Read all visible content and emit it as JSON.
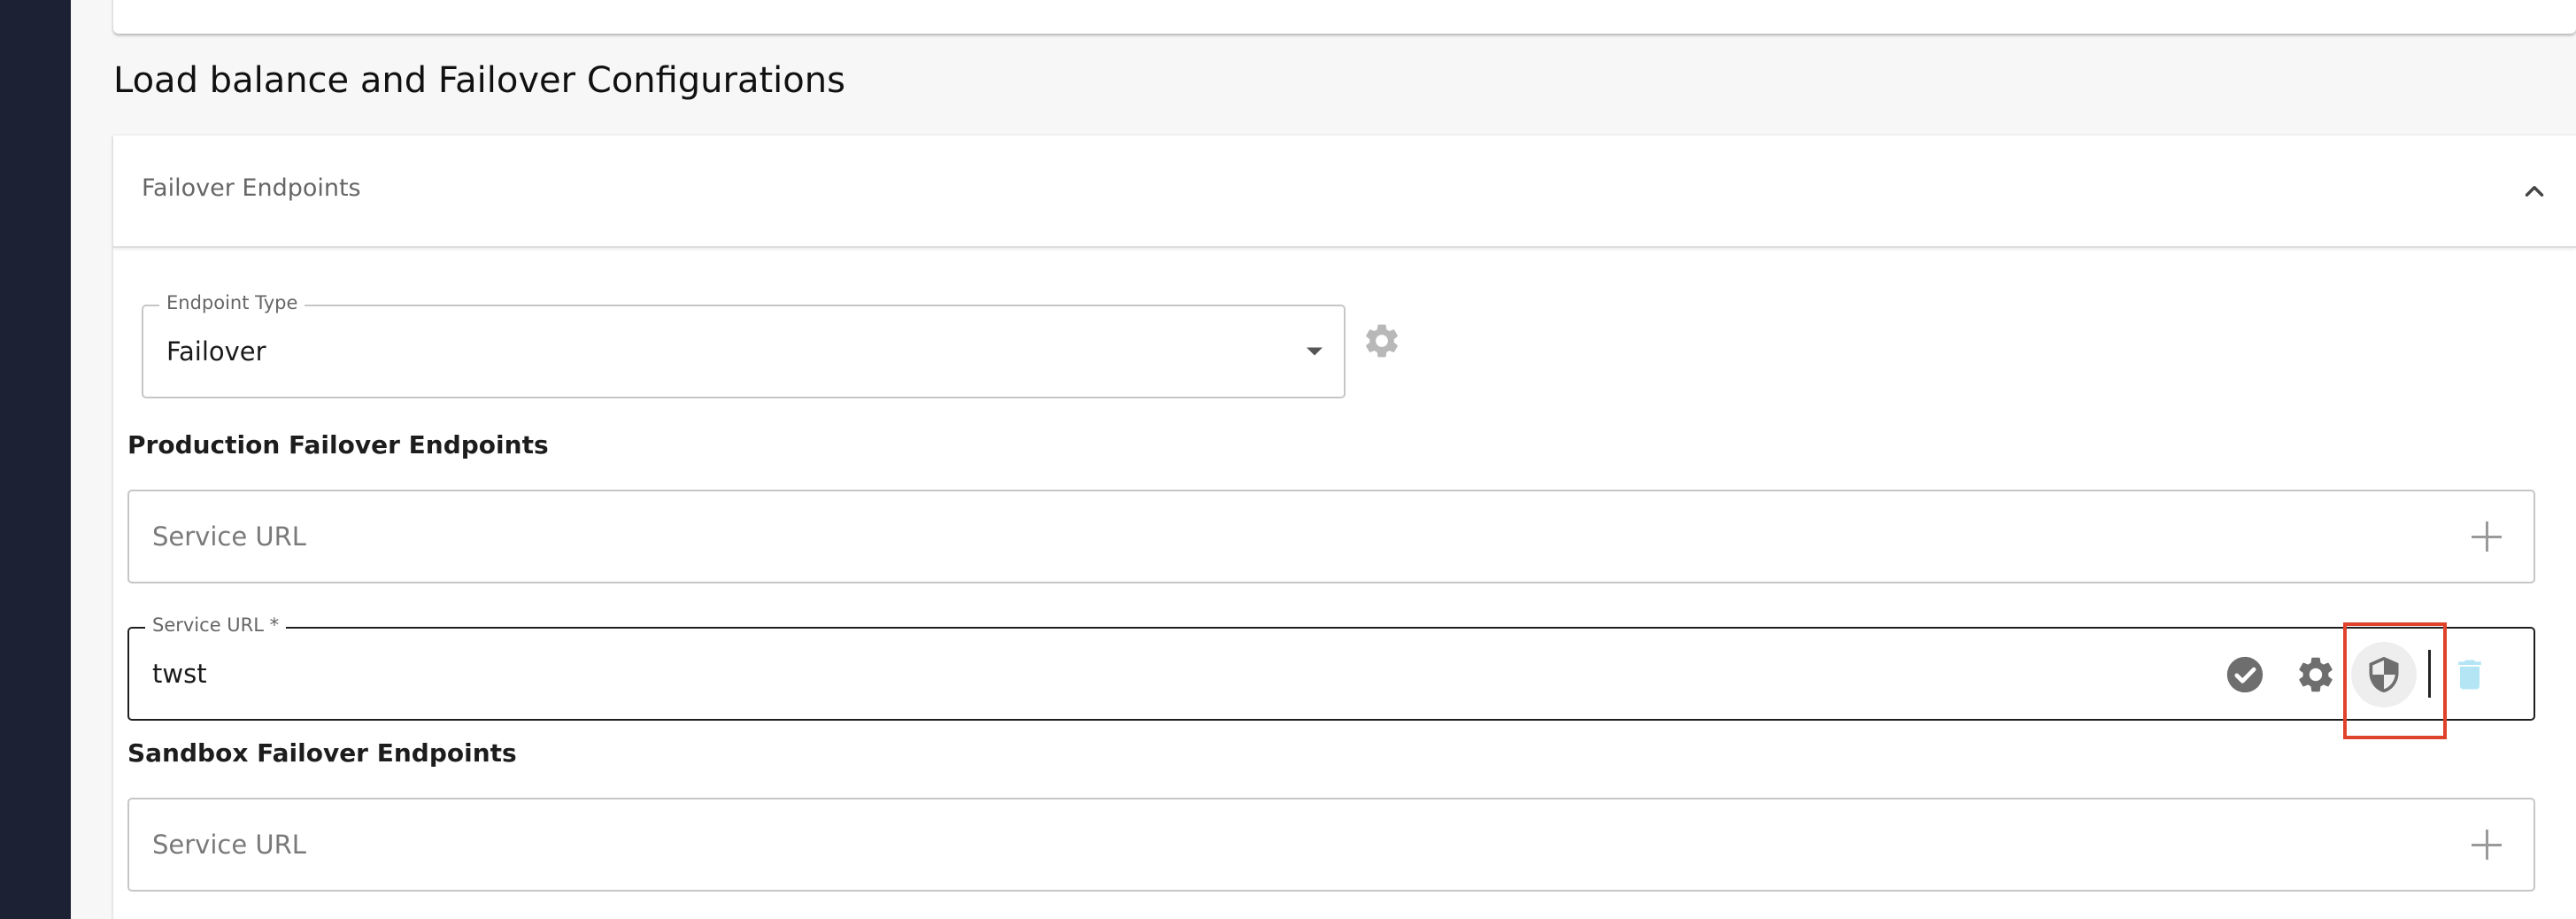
{
  "section": {
    "title": "Load balance and Failover Configurations"
  },
  "panel": {
    "header_title": "Failover Endpoints",
    "expanded": true
  },
  "endpoint_type": {
    "legend": "Endpoint Type",
    "value": "Failover"
  },
  "production": {
    "heading": "Production Failover Endpoints",
    "new_url_placeholder": "Service URL",
    "entry": {
      "legend": "Service URL *",
      "value": "twst"
    }
  },
  "sandbox": {
    "heading": "Sandbox Failover Endpoints",
    "new_url_placeholder": "Service URL"
  },
  "colors": {
    "sidebar": "#1d2134",
    "highlight": "#e0432b",
    "delete_icon": "#b3e5f5",
    "icon_gray": "#6e6e6e"
  },
  "icons": {
    "collapse": "chevron-up-icon",
    "endpoint_settings": "gear-icon",
    "add": "plus-icon",
    "confirm": "check-circle-icon",
    "settings": "gear-icon",
    "security": "shield-icon",
    "delete": "trash-icon"
  }
}
